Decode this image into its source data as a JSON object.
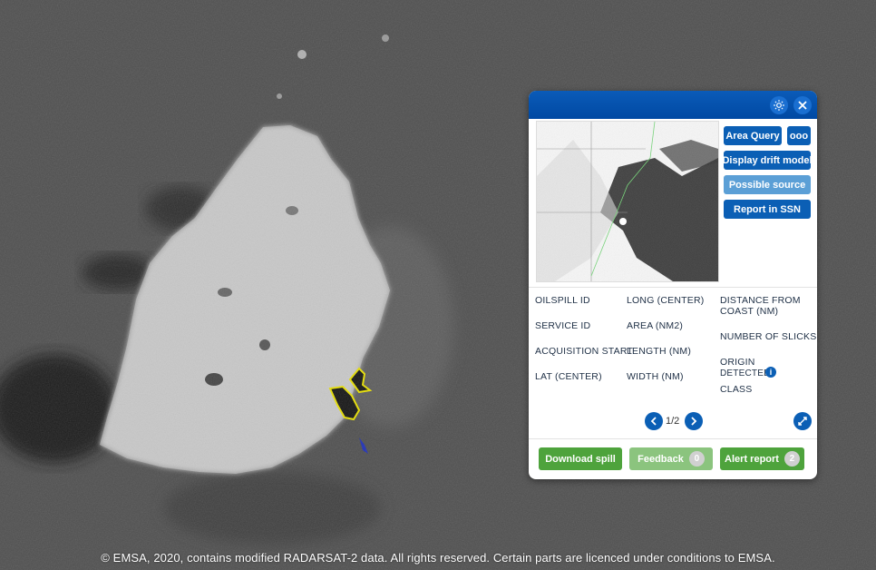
{
  "map": {
    "copyright": "© EMSA, 2020, contains modified RADARSAT-2 data. All rights reserved. Certain parts are licenced under conditions to EMSA."
  },
  "panel": {
    "header_icons": [
      "gear-icon",
      "close-icon"
    ],
    "buttons": {
      "area_query": "Area Query",
      "more": "ooo",
      "display_drift_model": "Display drift model",
      "possible_source": "Possible source",
      "report_in_ssn": "Report in SSN"
    },
    "fields": {
      "oilspill_id": "OILSPILL ID",
      "service_id": "SERVICE ID",
      "acquisition_start": "ACQUISITION START",
      "lat_center": "LAT (CENTER)",
      "long_center": "LONG (CENTER)",
      "area": "AREA (NM2)",
      "length": "LENGTH (NM)",
      "width": "WIDTH (NM)",
      "distance_from_coast": "DISTANCE FROM COAST (NM)",
      "number_of_slicks": "NUMBER OF SLICKS",
      "origin": "ORIGIN",
      "detected": "DETECTED",
      "class": "CLASS"
    },
    "pager": {
      "text": "1/2"
    },
    "actions": {
      "download_spill": "Download spill",
      "feedback": "Feedback",
      "feedback_count": "0",
      "alert_report": "Alert report",
      "alert_count": "2"
    }
  }
}
